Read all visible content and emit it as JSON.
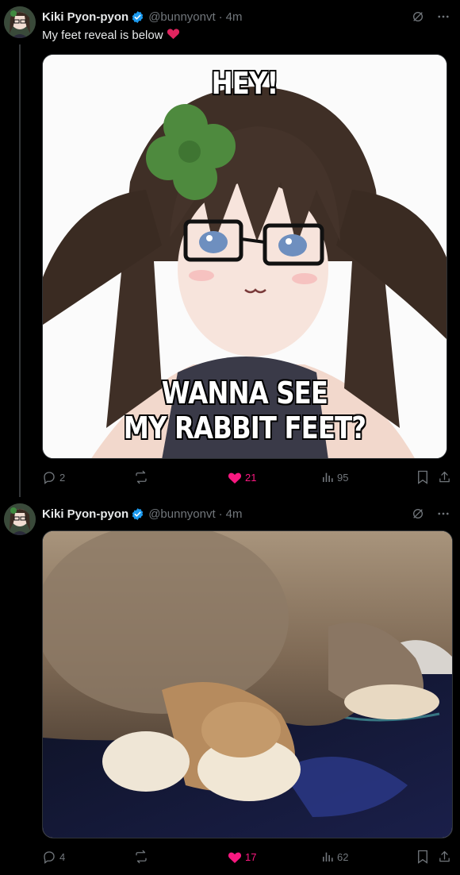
{
  "tweets": [
    {
      "author": {
        "name": "Kiki Pyon-pyon",
        "handle": "@bunnyonvt",
        "verified": true,
        "avatar": "anime-avatar"
      },
      "time": "4m",
      "text": "My feet reveal is below",
      "emoji": "heart-emoji",
      "media": {
        "kind": "meme-image",
        "caption_top": "HEY!",
        "caption_bottom_line1": "WANNA SEE",
        "caption_bottom_line2": "MY RABBIT FEET?"
      },
      "stats": {
        "replies": "2",
        "retweets": "",
        "likes": "21",
        "views": "95"
      },
      "liked": true
    },
    {
      "author": {
        "name": "Kiki Pyon-pyon",
        "handle": "@bunnyonvt",
        "verified": true,
        "avatar": "anime-avatar"
      },
      "time": "4m",
      "text": "",
      "media": {
        "kind": "rabbit-feet-photo"
      },
      "stats": {
        "replies": "4",
        "retweets": "",
        "likes": "17",
        "views": "62"
      },
      "liked": true
    }
  ],
  "colors": {
    "background": "#000000",
    "text": "#e7e9ea",
    "muted": "#71767b",
    "like": "#f91880",
    "verified": "#1d9bf0"
  },
  "separator": "·"
}
